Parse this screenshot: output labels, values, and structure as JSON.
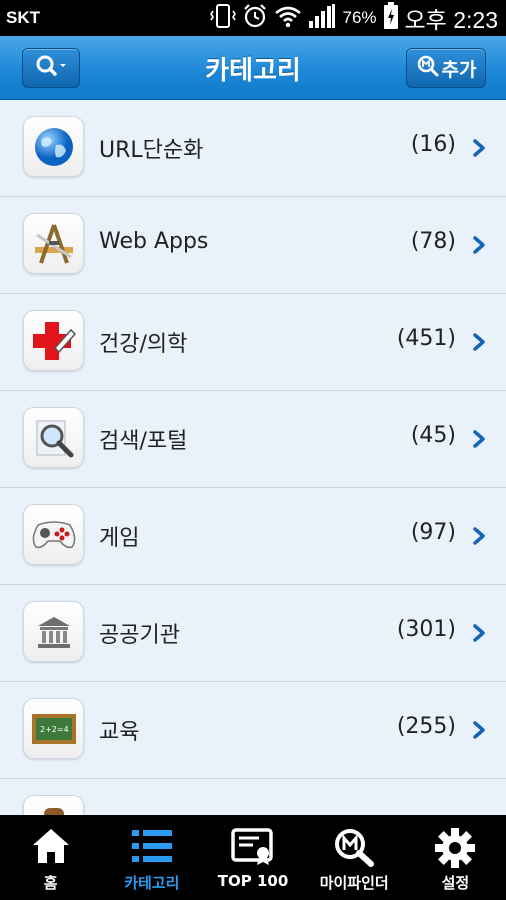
{
  "status_bar": {
    "carrier": "SKT",
    "battery_percent": "76%",
    "time": "오후 2:23",
    "icons": [
      "vibrate-icon",
      "alarm-icon",
      "wifi-icon",
      "signal-icon",
      "battery-icon"
    ]
  },
  "header": {
    "title": "카테고리",
    "search_button_icon": "search-dropdown-icon",
    "add_button_label": "추가",
    "add_button_icon": "search-badge-icon"
  },
  "categories": [
    {
      "label": "URL단순화",
      "count": "(16)",
      "icon": "globe-icon"
    },
    {
      "label": "Web Apps",
      "count": "(78)",
      "icon": "app-tools-icon"
    },
    {
      "label": "건강/의학",
      "count": "(451)",
      "icon": "medical-cross-icon"
    },
    {
      "label": "검색/포털",
      "count": "(45)",
      "icon": "magnifier-icon"
    },
    {
      "label": "게임",
      "count": "(97)",
      "icon": "gamepad-icon"
    },
    {
      "label": "공공기관",
      "count": "(301)",
      "icon": "government-building-icon"
    },
    {
      "label": "교육",
      "count": "(255)",
      "icon": "chalkboard-icon"
    },
    {
      "label": "",
      "count": "",
      "icon": "partial-icon"
    }
  ],
  "tabs": [
    {
      "label": "홈",
      "icon": "home-icon",
      "active": false
    },
    {
      "label": "카테고리",
      "icon": "list-icon",
      "active": true
    },
    {
      "label": "TOP 100",
      "icon": "certificate-icon",
      "active": false
    },
    {
      "label": "마이파인더",
      "icon": "m-search-icon",
      "active": false
    },
    {
      "label": "설정",
      "icon": "gear-icon",
      "active": false
    }
  ],
  "colors": {
    "header_blue": "#1b86d6",
    "list_background": "#e9f1fb",
    "active_tab": "#2a9bf0",
    "chevron": "#1565b5"
  }
}
